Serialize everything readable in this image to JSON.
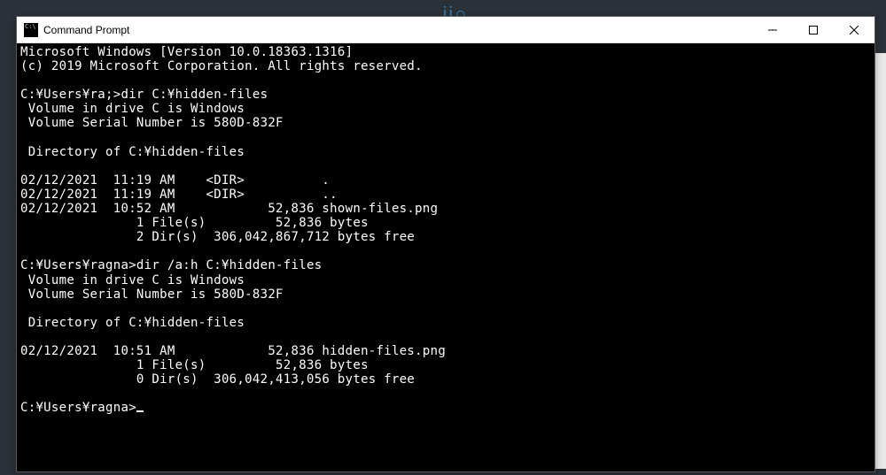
{
  "window": {
    "title": "Command Prompt",
    "icon_label": "C:\\"
  },
  "terminal": {
    "lines": [
      "Microsoft Windows [Version 10.0.18363.1316]",
      "(c) 2019 Microsoft Corporation. All rights reserved.",
      "",
      "C:¥Users¥ra;>dir C:¥hidden-files",
      " Volume in drive C is Windows",
      " Volume Serial Number is 580D-832F",
      "",
      " Directory of C:¥hidden-files",
      "",
      "02/12/2021  11:19 AM    <DIR>          .",
      "02/12/2021  11:19 AM    <DIR>          ..",
      "02/12/2021  10:52 AM            52,836 shown-files.png",
      "               1 File(s)         52,836 bytes",
      "               2 Dir(s)  306,042,867,712 bytes free",
      "",
      "C:¥Users¥ragna>dir /a:h C:¥hidden-files",
      " Volume in drive C is Windows",
      " Volume Serial Number is 580D-832F",
      "",
      " Directory of C:¥hidden-files",
      "",
      "02/12/2021  10:51 AM            52,836 hidden-files.png",
      "               1 File(s)         52,836 bytes",
      "               0 Dir(s)  306,042,413,056 bytes free",
      "",
      "C:¥Users¥ragna>"
    ]
  },
  "bg": {
    "decoration": "ii∩"
  }
}
